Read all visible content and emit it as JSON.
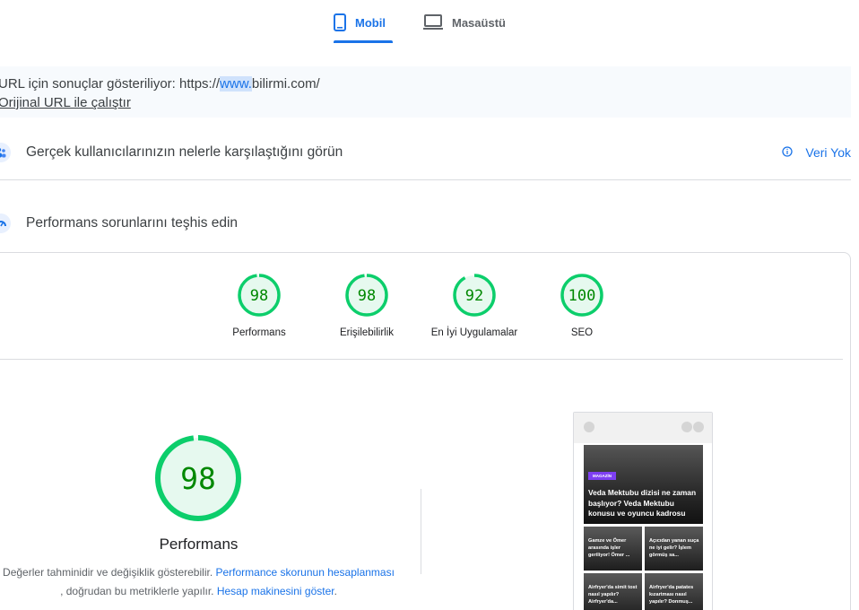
{
  "tabs": {
    "mobile_label": "Mobil",
    "desktop_label": "Masaüstü"
  },
  "url_banner": {
    "prefix": "URL için sonuçlar gösteriliyor: https://",
    "highlight": "www.",
    "suffix": "bilirmi.com/",
    "original_link": "Orijinal URL ile çalıştır"
  },
  "field_data": {
    "title": "Gerçek kullanıcılarınızın nelerle karşılaştığını görün",
    "no_data": "Veri Yok"
  },
  "diagnose": {
    "title": "Performans sorunlarını teşhis edin"
  },
  "scores": [
    {
      "value": "98",
      "label": "Performans",
      "fraction": 0.98
    },
    {
      "value": "98",
      "label": "Erişilebilirlik",
      "fraction": 0.98
    },
    {
      "value": "92",
      "label": "En İyi Uygulamalar",
      "fraction": 0.92
    },
    {
      "value": "100",
      "label": "SEO",
      "fraction": 1.0
    }
  ],
  "main_score": {
    "value": "98",
    "fraction": 0.98,
    "title": "Performans",
    "desc_1": "Değerler tahminidir ve değişiklik gösterebilir. ",
    "link_1": "Performance skorunun hesaplanması",
    "desc_2": " , doğrudan bu metriklerle yapılır. ",
    "link_2": "Hesap makinesini göster",
    "desc_3": "."
  },
  "thumbnail": {
    "badge": "MAGAZİN",
    "hero_title": "Veda Mektubu dizisi ne zaman başlıyor? Veda Mektubu konusu ve oyuncu kadrosu",
    "tiles": [
      "Gamze ve Ömer arasında işler geriliyor! Ömer ...",
      "Açıcıdan yanan suça ne iyi gelir? İşlem görmüş sa...",
      "Airfryer'da simit tost nasıl yapılır? Airfryer'da...",
      "Airfryer'da patates kızartması nasıl yapılır? Donmuş..."
    ]
  },
  "colors": {
    "accent": "#1a73e8",
    "score_green": "#0cce6b",
    "score_text": "#008800",
    "score_bg": "#e6f9ef"
  }
}
